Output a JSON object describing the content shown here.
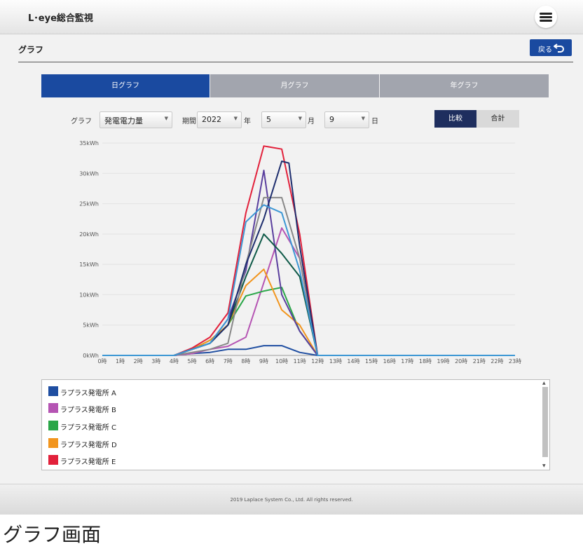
{
  "app": {
    "title": "L･eye総合監視",
    "menu_icon": "hamburger-menu-icon"
  },
  "page": {
    "title": "グラフ",
    "back_label": "戻る",
    "back_icon": "undo-arrow-icon"
  },
  "tabs": [
    {
      "label": "日グラフ",
      "active": true
    },
    {
      "label": "月グラフ",
      "active": false
    },
    {
      "label": "年グラフ",
      "active": false
    }
  ],
  "filters": {
    "graph_label": "グラフ",
    "graph_value": "発電電力量",
    "period_label": "期間",
    "year_value": "2022",
    "year_unit": "年",
    "month_value": "5",
    "month_unit": "月",
    "day_value": "9",
    "day_unit": "日"
  },
  "mode_toggle": [
    {
      "label": "比較",
      "active": true
    },
    {
      "label": "合計",
      "active": false
    }
  ],
  "colors": {
    "accent": "#1a4aa0",
    "inactive_tab": "#a2a5ae"
  },
  "chart_data": {
    "type": "line",
    "x": [
      "0時",
      "1時",
      "2時",
      "3時",
      "4時",
      "5時",
      "6時",
      "7時",
      "8時",
      "9時",
      "10時",
      "11時",
      "12時",
      "13時",
      "14時",
      "15時",
      "16時",
      "17時",
      "18時",
      "19時",
      "20時",
      "21時",
      "22時",
      "23時"
    ],
    "yticks": [
      "0kWh",
      "5kWh",
      "10kWh",
      "15kWh",
      "20kWh",
      "25kWh",
      "30kWh",
      "35kWh"
    ],
    "ylim": [
      0,
      35
    ],
    "grid": true,
    "series": [
      {
        "name": "ラプラス発電所A",
        "color": "#1f4ea1",
        "visible": [
          [
            0,
            0
          ],
          [
            4,
            0
          ],
          [
            5,
            0.3
          ],
          [
            6,
            0.5
          ],
          [
            7,
            1
          ],
          [
            8,
            1
          ],
          [
            9,
            1.6
          ],
          [
            10,
            1.6
          ],
          [
            11,
            0.5
          ],
          [
            12,
            0
          ],
          [
            23,
            0
          ]
        ]
      },
      {
        "name": "ラプラス発電所B",
        "color": "#b554b3",
        "visible": [
          [
            0,
            0
          ],
          [
            4,
            0
          ],
          [
            5,
            0.3
          ],
          [
            6,
            1
          ],
          [
            7,
            1.5
          ],
          [
            8,
            3
          ],
          [
            9,
            12
          ],
          [
            10,
            21
          ],
          [
            11,
            16
          ],
          [
            12,
            0
          ],
          [
            23,
            0
          ]
        ]
      },
      {
        "name": "ラプラス発電所C",
        "color": "#2aa648",
        "visible": [
          [
            0,
            0
          ],
          [
            4,
            0
          ],
          [
            5,
            1
          ],
          [
            6,
            2.5
          ],
          [
            7,
            5
          ],
          [
            8,
            9.8
          ],
          [
            9,
            10.6
          ],
          [
            10,
            11.2
          ],
          [
            11,
            4
          ],
          [
            12,
            0
          ],
          [
            23,
            0
          ]
        ]
      },
      {
        "name": "ラプラス発電所D",
        "color": "#f2951d",
        "visible": [
          [
            0,
            0
          ],
          [
            4,
            0
          ],
          [
            5,
            1
          ],
          [
            6,
            2.5
          ],
          [
            7,
            5
          ],
          [
            8,
            11.5
          ],
          [
            9,
            14.2
          ],
          [
            10,
            7.5
          ],
          [
            11,
            5
          ],
          [
            12,
            0
          ],
          [
            23,
            0
          ]
        ]
      },
      {
        "name": "ラプラス発電所E",
        "color": "#e2213b",
        "visible": [
          [
            0,
            0
          ],
          [
            4,
            0
          ],
          [
            5,
            1.2
          ],
          [
            6,
            3
          ],
          [
            7,
            7
          ],
          [
            8,
            23.5
          ],
          [
            9,
            34.5
          ],
          [
            10,
            34
          ],
          [
            11,
            20
          ],
          [
            12,
            0
          ],
          [
            23,
            0
          ]
        ]
      },
      {
        "color": "#5a3f9e",
        "visible": [
          [
            0,
            0
          ],
          [
            4,
            0
          ],
          [
            5,
            1
          ],
          [
            6,
            2
          ],
          [
            7,
            6
          ],
          [
            8,
            14
          ],
          [
            9,
            30.5
          ],
          [
            10,
            10
          ],
          [
            11,
            4
          ],
          [
            12,
            0
          ],
          [
            23,
            0
          ]
        ]
      },
      {
        "color": "#0f5a48",
        "visible": [
          [
            0,
            0
          ],
          [
            4,
            0
          ],
          [
            5,
            1
          ],
          [
            6,
            2
          ],
          [
            7,
            5
          ],
          [
            8,
            13
          ],
          [
            9,
            20
          ],
          [
            10,
            16.8
          ],
          [
            11,
            13
          ],
          [
            12,
            0
          ],
          [
            23,
            0
          ]
        ]
      },
      {
        "color": "#888888",
        "visible": [
          [
            0,
            0
          ],
          [
            4,
            0
          ],
          [
            5,
            0.5
          ],
          [
            6,
            1
          ],
          [
            7,
            2
          ],
          [
            8,
            15
          ],
          [
            9,
            26
          ],
          [
            10,
            26
          ],
          [
            11,
            16
          ],
          [
            12,
            0
          ],
          [
            23,
            0
          ]
        ]
      },
      {
        "color": "#1e2e6e",
        "visible": [
          [
            0,
            0
          ],
          [
            4,
            0
          ],
          [
            5,
            1
          ],
          [
            6,
            2
          ],
          [
            7,
            5
          ],
          [
            8,
            15
          ],
          [
            9,
            22.5
          ],
          [
            10,
            32
          ],
          [
            10.4,
            31.7
          ],
          [
            11,
            18
          ],
          [
            12,
            0
          ],
          [
            23,
            0
          ]
        ]
      },
      {
        "color": "#3c97d4",
        "visible": [
          [
            0,
            0
          ],
          [
            4,
            0
          ],
          [
            5,
            1
          ],
          [
            6,
            2
          ],
          [
            7,
            6
          ],
          [
            8,
            22
          ],
          [
            9,
            24.8
          ],
          [
            10,
            23.5
          ],
          [
            11,
            14
          ],
          [
            12,
            0
          ],
          [
            23,
            0
          ]
        ]
      }
    ]
  },
  "legend": {
    "items": [
      {
        "label": "ラプラス発電所 A",
        "color": "#1f4ea1"
      },
      {
        "label": "ラプラス発電所 B",
        "color": "#b554b3"
      },
      {
        "label": "ラプラス発電所 C",
        "color": "#2aa648"
      },
      {
        "label": "ラプラス発電所 D",
        "color": "#f2951d"
      },
      {
        "label": "ラプラス発電所 E",
        "color": "#e2213b"
      }
    ]
  },
  "footer": {
    "copyright": "2019 Laplace System Co., Ltd. All rights reserved."
  },
  "caption": "グラフ画面"
}
